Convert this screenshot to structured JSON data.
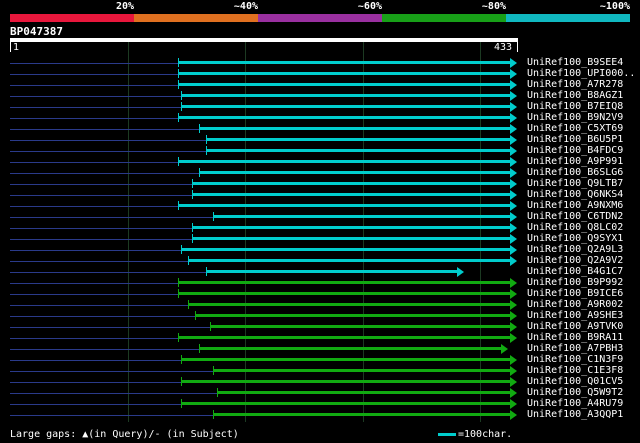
{
  "scale": {
    "labels": [
      "20%",
      "~40%",
      "~60%",
      "~80%",
      "~100%"
    ],
    "colors": [
      "#e8173c",
      "#e07020",
      "#9a30a0",
      "#18a018",
      "#10b8c0"
    ]
  },
  "query": {
    "id": "BP047387",
    "start": "1",
    "end": "433"
  },
  "hits": [
    {
      "name": "UniRef100_B9SEE4",
      "start": 144,
      "end": 433,
      "color": "#0cc"
    },
    {
      "name": "UniRef100_UPI000..",
      "start": 144,
      "end": 433,
      "color": "#0cc"
    },
    {
      "name": "UniRef100_A7R278",
      "start": 144,
      "end": 433,
      "color": "#0cc"
    },
    {
      "name": "UniRef100_B8AGZ1",
      "start": 147,
      "end": 433,
      "color": "#0cc"
    },
    {
      "name": "UniRef100_B7EIQ8",
      "start": 147,
      "end": 433,
      "color": "#0cc"
    },
    {
      "name": "UniRef100_B9N2V9",
      "start": 144,
      "end": 433,
      "color": "#0cc"
    },
    {
      "name": "UniRef100_C5XT69",
      "start": 162,
      "end": 433,
      "color": "#0cc"
    },
    {
      "name": "UniRef100_B6U5P1",
      "start": 168,
      "end": 433,
      "color": "#0cc"
    },
    {
      "name": "UniRef100_B4FDC9",
      "start": 168,
      "end": 433,
      "color": "#0cc"
    },
    {
      "name": "UniRef100_A9P991",
      "start": 144,
      "end": 433,
      "color": "#0cc"
    },
    {
      "name": "UniRef100_B6SLG6",
      "start": 162,
      "end": 433,
      "color": "#0cc"
    },
    {
      "name": "UniRef100_Q9LTB7",
      "start": 156,
      "end": 433,
      "color": "#0cc"
    },
    {
      "name": "UniRef100_Q6NKS4",
      "start": 156,
      "end": 433,
      "color": "#0cc"
    },
    {
      "name": "UniRef100_A9NXM6",
      "start": 144,
      "end": 433,
      "color": "#0cc"
    },
    {
      "name": "UniRef100_C6TDN2",
      "start": 174,
      "end": 433,
      "color": "#0cc"
    },
    {
      "name": "UniRef100_Q8LC02",
      "start": 156,
      "end": 433,
      "color": "#0cc"
    },
    {
      "name": "UniRef100_Q9SYX1",
      "start": 156,
      "end": 433,
      "color": "#0cc"
    },
    {
      "name": "UniRef100_Q2A9L3",
      "start": 147,
      "end": 433,
      "color": "#0cc"
    },
    {
      "name": "UniRef100_Q2A9V2",
      "start": 153,
      "end": 433,
      "color": "#0cc"
    },
    {
      "name": "UniRef100_B4G1C7",
      "start": 168,
      "end": 388,
      "color": "#0cc"
    },
    {
      "name": "UniRef100_B9P992",
      "start": 144,
      "end": 433,
      "color": "#1a1"
    },
    {
      "name": "UniRef100_B9ICE6",
      "start": 144,
      "end": 433,
      "color": "#1a1"
    },
    {
      "name": "UniRef100_A9R002",
      "start": 153,
      "end": 433,
      "color": "#1a1"
    },
    {
      "name": "UniRef100_A9SHE3",
      "start": 159,
      "end": 433,
      "color": "#1a1"
    },
    {
      "name": "UniRef100_A9TVK0",
      "start": 171,
      "end": 433,
      "color": "#1a1"
    },
    {
      "name": "UniRef100_B9RA11",
      "start": 144,
      "end": 433,
      "color": "#1a1"
    },
    {
      "name": "UniRef100_A7PBH3",
      "start": 162,
      "end": 425,
      "color": "#1a1"
    },
    {
      "name": "UniRef100_C1N3F9",
      "start": 147,
      "end": 433,
      "color": "#1a1"
    },
    {
      "name": "UniRef100_C1E3F8",
      "start": 174,
      "end": 433,
      "color": "#1a1"
    },
    {
      "name": "UniRef100_Q01CV5",
      "start": 147,
      "end": 433,
      "color": "#1a1"
    },
    {
      "name": "UniRef100_Q5W9T2",
      "start": 177,
      "end": 433,
      "color": "#1a1"
    },
    {
      "name": "UniRef100_A4RU79",
      "start": 147,
      "end": 433,
      "color": "#1a1"
    },
    {
      "name": "UniRef100_A3QQP1",
      "start": 174,
      "end": 433,
      "color": "#1a1"
    }
  ],
  "legend": {
    "large_gaps": "Large gaps: ▲(in Query)/- (in Subject)",
    "scale_text": "=100char.",
    "scale_color": "#0cc"
  }
}
